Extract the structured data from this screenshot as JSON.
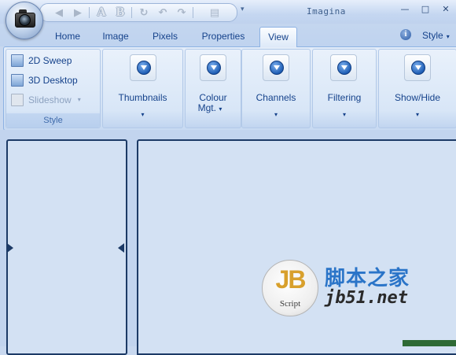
{
  "window": {
    "title": "Imagina",
    "controls": {
      "minimize": "—",
      "maximize": "□",
      "close": "✕"
    }
  },
  "quick_access_toolbar": {
    "items": [
      {
        "icon": "back-arrow-icon",
        "glyph": "◀"
      },
      {
        "icon": "forward-arrow-icon",
        "glyph": "▶"
      },
      {
        "icon": "text-a-icon",
        "glyph": "A"
      },
      {
        "icon": "text-b-icon",
        "glyph": "B"
      },
      {
        "icon": "rotate-icon",
        "glyph": "↻"
      },
      {
        "icon": "undo-icon",
        "glyph": "↶"
      },
      {
        "icon": "redo-icon",
        "glyph": "↷"
      },
      {
        "icon": "save-icon",
        "glyph": "▤"
      }
    ],
    "dropdown_glyph": "▾"
  },
  "tabs": [
    {
      "label": "Home",
      "active": false
    },
    {
      "label": "Image",
      "active": false
    },
    {
      "label": "Pixels",
      "active": false
    },
    {
      "label": "Properties",
      "active": false
    },
    {
      "label": "View",
      "active": true
    }
  ],
  "help_icon": "i",
  "style_menu": {
    "label": "Style",
    "caret": "▾"
  },
  "ribbon": {
    "style_group": {
      "label": "Style",
      "items": [
        {
          "label": "2D Sweep",
          "enabled": true
        },
        {
          "label": "3D Desktop",
          "enabled": true
        },
        {
          "label": "Slideshow",
          "enabled": false,
          "caret": "▾"
        }
      ]
    },
    "buttons": [
      {
        "label": "Thumbnails",
        "caret": "▾"
      },
      {
        "label": "Colour",
        "label2": "Mgt.",
        "caret": "▾"
      },
      {
        "label": "Channels",
        "caret": "▾"
      },
      {
        "label": "Filtering",
        "caret": "▾"
      },
      {
        "label": "Show/Hide",
        "caret": "▾"
      }
    ]
  },
  "watermark": {
    "badge_letters": "JB",
    "badge_sub": "Script",
    "site_name": "脚本之家",
    "site_url": "jb51.net"
  },
  "colors": {
    "accent": "#15428b",
    "ribbon_border": "#8db2e3",
    "panel_border": "#1c3a66",
    "badge_gold": "#d8a02c",
    "site_blue": "#2a74c8"
  }
}
